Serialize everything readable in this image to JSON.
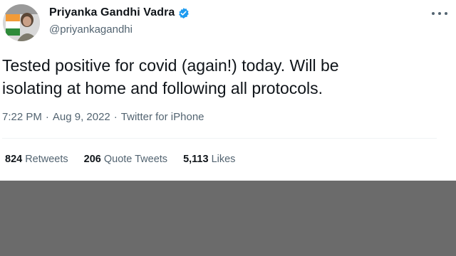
{
  "tweet": {
    "author_name": "Priyanka Gandhi Vadra",
    "handle": "@priyankagandhi",
    "text_line1": "Tested positive for covid (again!) today. Will be",
    "text_line2": "isolating at home and following all protocols.",
    "time": "7:22 PM",
    "date": "Aug 9, 2022",
    "source": "Twitter for iPhone",
    "separator": "·"
  },
  "stats": [
    {
      "count": "824",
      "label": "Retweets"
    },
    {
      "count": "206",
      "label": "Quote Tweets"
    },
    {
      "count": "5,113",
      "label": "Likes"
    }
  ],
  "colors": {
    "verified_blue": "#1d9bf0",
    "secondary_text": "#536471",
    "primary_text": "#0f1419",
    "overlay_gray": "#6b6b6b"
  },
  "icons": {
    "avatar": "profile-photo",
    "verified": "verified-badge-icon",
    "more": "more-options-icon"
  }
}
